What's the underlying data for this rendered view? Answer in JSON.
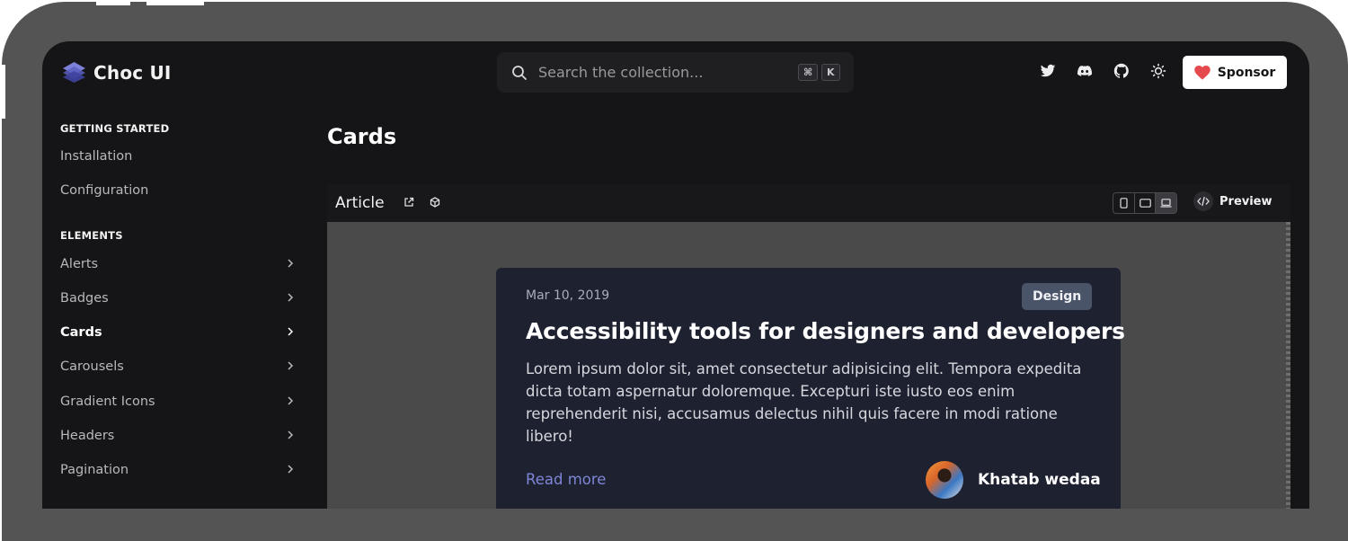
{
  "app": {
    "name": "Choc UI"
  },
  "search": {
    "placeholder": "Search the collection...",
    "kbd_cmd": "⌘",
    "kbd_k": "K"
  },
  "header": {
    "icons": [
      "twitter-icon",
      "discord-icon",
      "github-icon",
      "theme-toggle-icon"
    ],
    "sponsor_label": "Sponsor"
  },
  "sidebar": {
    "sections": [
      {
        "heading": "GETTING STARTED",
        "items": [
          "Installation",
          "Configuration"
        ]
      },
      {
        "heading": "ELEMENTS",
        "items": [
          "Alerts",
          "Badges",
          "Cards",
          "Carousels",
          "Gradient Icons",
          "Headers",
          "Pagination"
        ]
      }
    ],
    "active_item": "Cards"
  },
  "main": {
    "page_title": "Cards",
    "panel": {
      "title": "Article",
      "preview_label": "Preview",
      "views": [
        "mobile",
        "tablet",
        "desktop"
      ],
      "selected_view": "desktop"
    },
    "card": {
      "date": "Mar 10, 2019",
      "tag": "Design",
      "title": "Accessibility tools for designers and developers",
      "body": "Lorem ipsum dolor sit, amet consectetur adipisicing elit. Tempora expedita dicta totam aspernatur doloremque. Excepturi iste iusto eos enim reprehenderit nisi, accusamus delectus nihil quis facere in modi ratione libero!",
      "read_more": "Read more",
      "author": "Khatab wedaa"
    }
  },
  "colors": {
    "background": "#151517",
    "accent": "#7d86d6",
    "card": "#1e2130",
    "tag": "#4a5468",
    "sponsor_heart": "#e5484d"
  }
}
